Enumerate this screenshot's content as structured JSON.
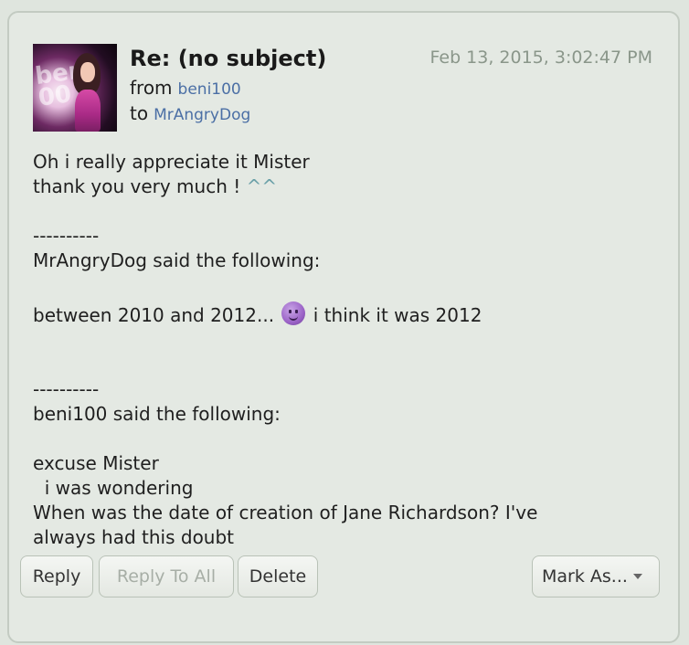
{
  "message": {
    "subject": "Re: (no subject)",
    "from_label": "from",
    "from_user": "beni100",
    "to_label": "to",
    "to_user": "MrAngryDog",
    "date": "Feb 13, 2015, 3:02:47 PM",
    "avatar_text": "beni\n00"
  },
  "body": {
    "line1": "Oh i really appreciate it Mister",
    "line2_text": "thank you very much ! ",
    "line2_emote": "^^",
    "sep1": "----------",
    "quote1_header": "MrAngryDog said the following:",
    "quote1_before": "between 2010 and 2012... ",
    "quote1_after": " i think it was 2012",
    "sep2": "----------",
    "quote2_header": "beni100 said the following:",
    "quote2_line1": "excuse Mister",
    "quote2_line2": "  i was wondering",
    "quote2_line3": "When was the date of creation of Jane Richardson? I've",
    "quote2_line4": "always had this doubt"
  },
  "buttons": {
    "reply": "Reply",
    "reply_all": "Reply To All",
    "delete": "Delete",
    "mark_as": "Mark As..."
  },
  "colors": {
    "background": "#dfe5de",
    "user_link": "#4b6fa5",
    "date": "#8a968a",
    "disabled_text": "#a7aea6"
  },
  "icons": {
    "smiley": "purple-smiley-icon",
    "dropdown": "chevron-down-icon"
  }
}
